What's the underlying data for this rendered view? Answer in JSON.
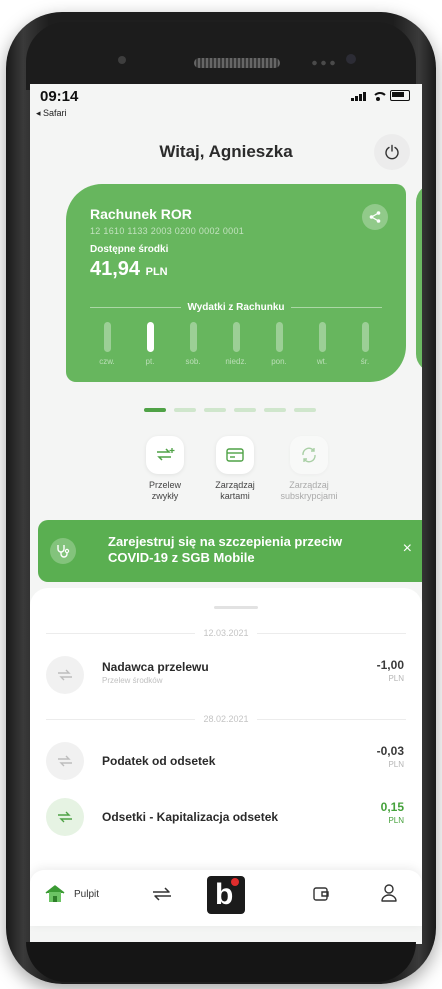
{
  "status": {
    "time": "09:14",
    "back_app": "◂ Safari"
  },
  "header": {
    "greeting": "Witaj, Agnieszka"
  },
  "account": {
    "name": "Rachunek ROR",
    "number": "12 1610 1133 2003 0200 0002 0001",
    "available_label": "Dostępne środki",
    "balance": "41,94",
    "currency": "PLN",
    "spending_title": "Wydatki z Rachunku",
    "days": [
      {
        "label": "czw.",
        "active": false
      },
      {
        "label": "pt.",
        "active": true
      },
      {
        "label": "sob.",
        "active": false
      },
      {
        "label": "niedz.",
        "active": false
      },
      {
        "label": "pon.",
        "active": false
      },
      {
        "label": "wt.",
        "active": false
      },
      {
        "label": "śr.",
        "active": false
      }
    ]
  },
  "pager": {
    "count": 6,
    "active": 0
  },
  "quick_actions": [
    {
      "line1": "Przelew",
      "line2": "zwykły",
      "icon": "transfer-plus-icon",
      "enabled": true
    },
    {
      "line1": "Zarządzaj",
      "line2": "kartami",
      "icon": "card-icon",
      "enabled": true
    },
    {
      "line1": "Zarządzaj",
      "line2": "subskrypcjami",
      "icon": "subscription-icon",
      "enabled": false
    }
  ],
  "banner": {
    "text": "Zarejestruj się na szczepienia przeciw COVID-19 z SGB Mobile",
    "close": "×"
  },
  "transactions": {
    "groups": [
      {
        "date": "12.03.2021",
        "items": [
          {
            "name": "Nadawca przelewu",
            "sub": "Przelew środków",
            "amount": "-1,00",
            "currency": "PLN",
            "positive": false
          }
        ]
      },
      {
        "date": "28.02.2021",
        "items": [
          {
            "name": "Podatek od odsetek",
            "sub": "",
            "amount": "-0,03",
            "currency": "PLN",
            "positive": false
          },
          {
            "name": "Odsetki - Kapitalizacja odsetek",
            "sub": "",
            "amount": "0,15",
            "currency": "PLN",
            "positive": true
          }
        ]
      }
    ]
  },
  "nav": {
    "home_label": "Pulpit",
    "logo_letter": "b"
  },
  "colors": {
    "brand_green": "#67b65e",
    "accent_green": "#4fa246",
    "positive": "#45a13b",
    "logo_red": "#e02d2d"
  }
}
